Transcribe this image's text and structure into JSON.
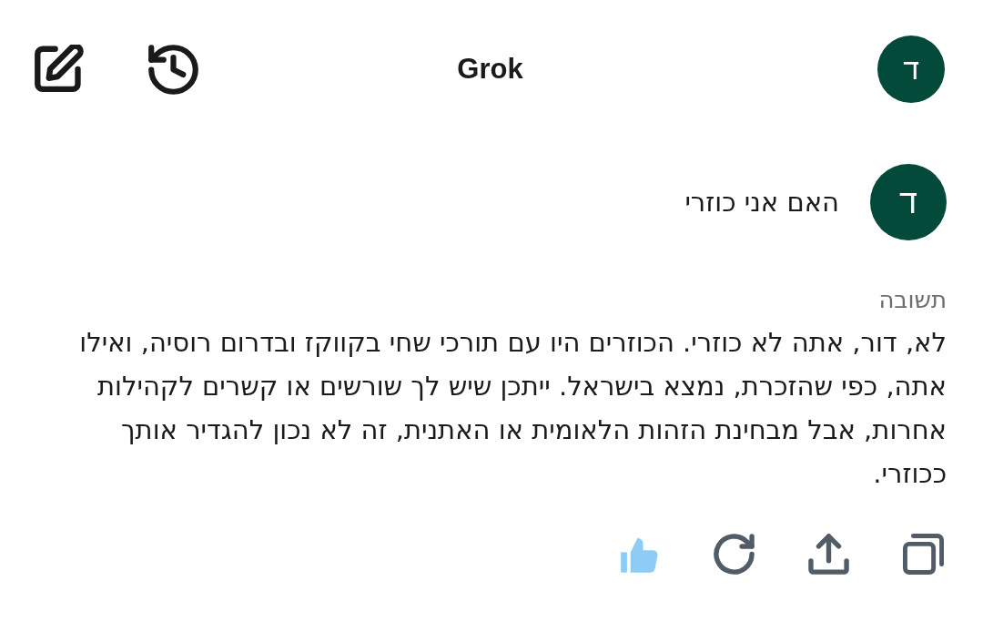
{
  "header": {
    "title": "Grok",
    "avatar_letter": "ד"
  },
  "messages": [
    {
      "kind": "user",
      "avatar_letter": "ד",
      "text": "האם אני כוזרי"
    },
    {
      "kind": "answer",
      "label": "תשובה",
      "text": "לא, דור, אתה לא כוזרי. הכוזרים היו עם תורכי שחי בקווקז ובדרום רוסיה, ואילו אתה, כפי שהזכרת, נמצא בישראל. ייתכן שיש לך שורשים או קשרים לקהילות אחרות, אבל מבחינת הזהות הלאומית או האתנית, זה לא נכון להגדיר אותך ככוזרי."
    }
  ],
  "actions": [
    {
      "kind": "like",
      "on": true
    },
    {
      "kind": "regenerate",
      "on": false
    },
    {
      "kind": "share",
      "on": false
    },
    {
      "kind": "copy",
      "on": false
    }
  ]
}
